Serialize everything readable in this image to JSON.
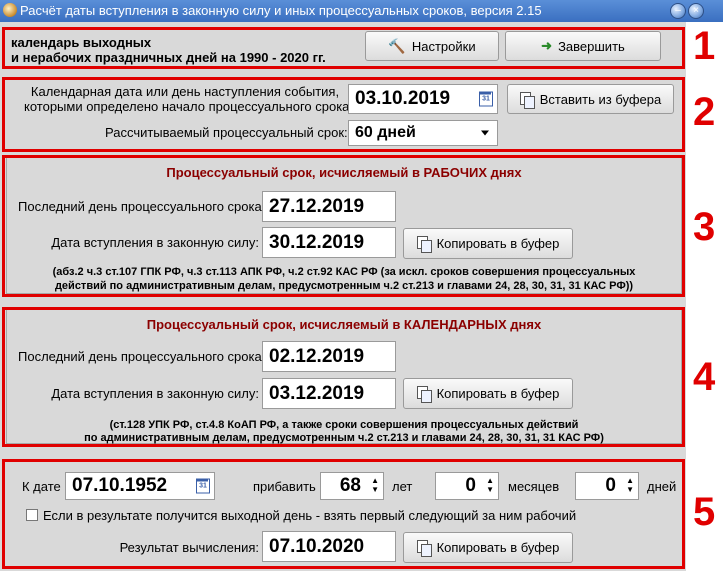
{
  "window": {
    "title": "Расчёт даты вступления в законную силу и иных процессуальных сроков, версия 2.15"
  },
  "header": {
    "calendar_info_line1": "календарь выходных",
    "calendar_info_line2": "и нерабочих праздничных дней на 1990 - 2020 гг.",
    "settings_label": "Настройки",
    "exit_label": "Завершить"
  },
  "input_section": {
    "event_date_label_line1": "Календарная дата или день наступления события,",
    "event_date_label_line2": "которыми определено начало процессуального срока:",
    "event_date_value": "03.10.2019",
    "paste_label": "Вставить из буфера",
    "term_label": "Рассчитываемый процессуальный срок:",
    "term_value": "60 дней"
  },
  "working_days": {
    "title": "Процессуальный срок, исчисляемый в РАБОЧИХ днях",
    "last_day_label": "Последний день процессуального срока:",
    "last_day_value": "27.12.2019",
    "effective_label": "Дата вступления в законную силу:",
    "effective_value": "30.12.2019",
    "copy_label": "Копировать в буфер",
    "note_line1": "(абз.2 ч.3 ст.107 ГПК РФ, ч.3 ст.113 АПК РФ, ч.2 ст.92 КАС РФ (за искл. сроков совершения процессуальных",
    "note_line2": "действий по административным делам, предусмотренным ч.2 ст.213 и главами 24, 28, 30, 31, 31 КАС РФ))"
  },
  "calendar_days": {
    "title": "Процессуальный срок, исчисляемый в КАЛЕНДАРНЫХ днях",
    "last_day_label": "Последний день процессуального срока:",
    "last_day_value": "02.12.2019",
    "effective_label": "Дата вступления в законную силу:",
    "effective_value": "03.12.2019",
    "copy_label": "Копировать в буфер",
    "note_line1": "(ст.128 УПК РФ, ст.4.8 КоАП РФ, а также сроки совершения процессуальных действий",
    "note_line2": "по административным делам, предусмотренным ч.2 ст.213 и главами 24, 28, 30, 31, 31 КАС РФ)"
  },
  "calculator": {
    "date_label": "К дате",
    "date_value": "07.10.1952",
    "add_label": "прибавить",
    "years_value": "68",
    "years_label": "лет",
    "months_value": "0",
    "months_label": "месяцев",
    "days_value": "0",
    "days_label": "дней",
    "weekend_checkbox_label": "Если в результате получится выходной день - взять первый следующий за ним рабочий",
    "result_label": "Результат вычисления:",
    "result_value": "07.10.2020",
    "copy_label": "Копировать в буфер"
  },
  "markers": [
    "1",
    "2",
    "3",
    "4",
    "5"
  ],
  "colors": {
    "title_bar": "#3a6fc0",
    "section_marker": "#e00000",
    "panel_title": "#8b0000",
    "client_bg": "#d9d9d9"
  }
}
